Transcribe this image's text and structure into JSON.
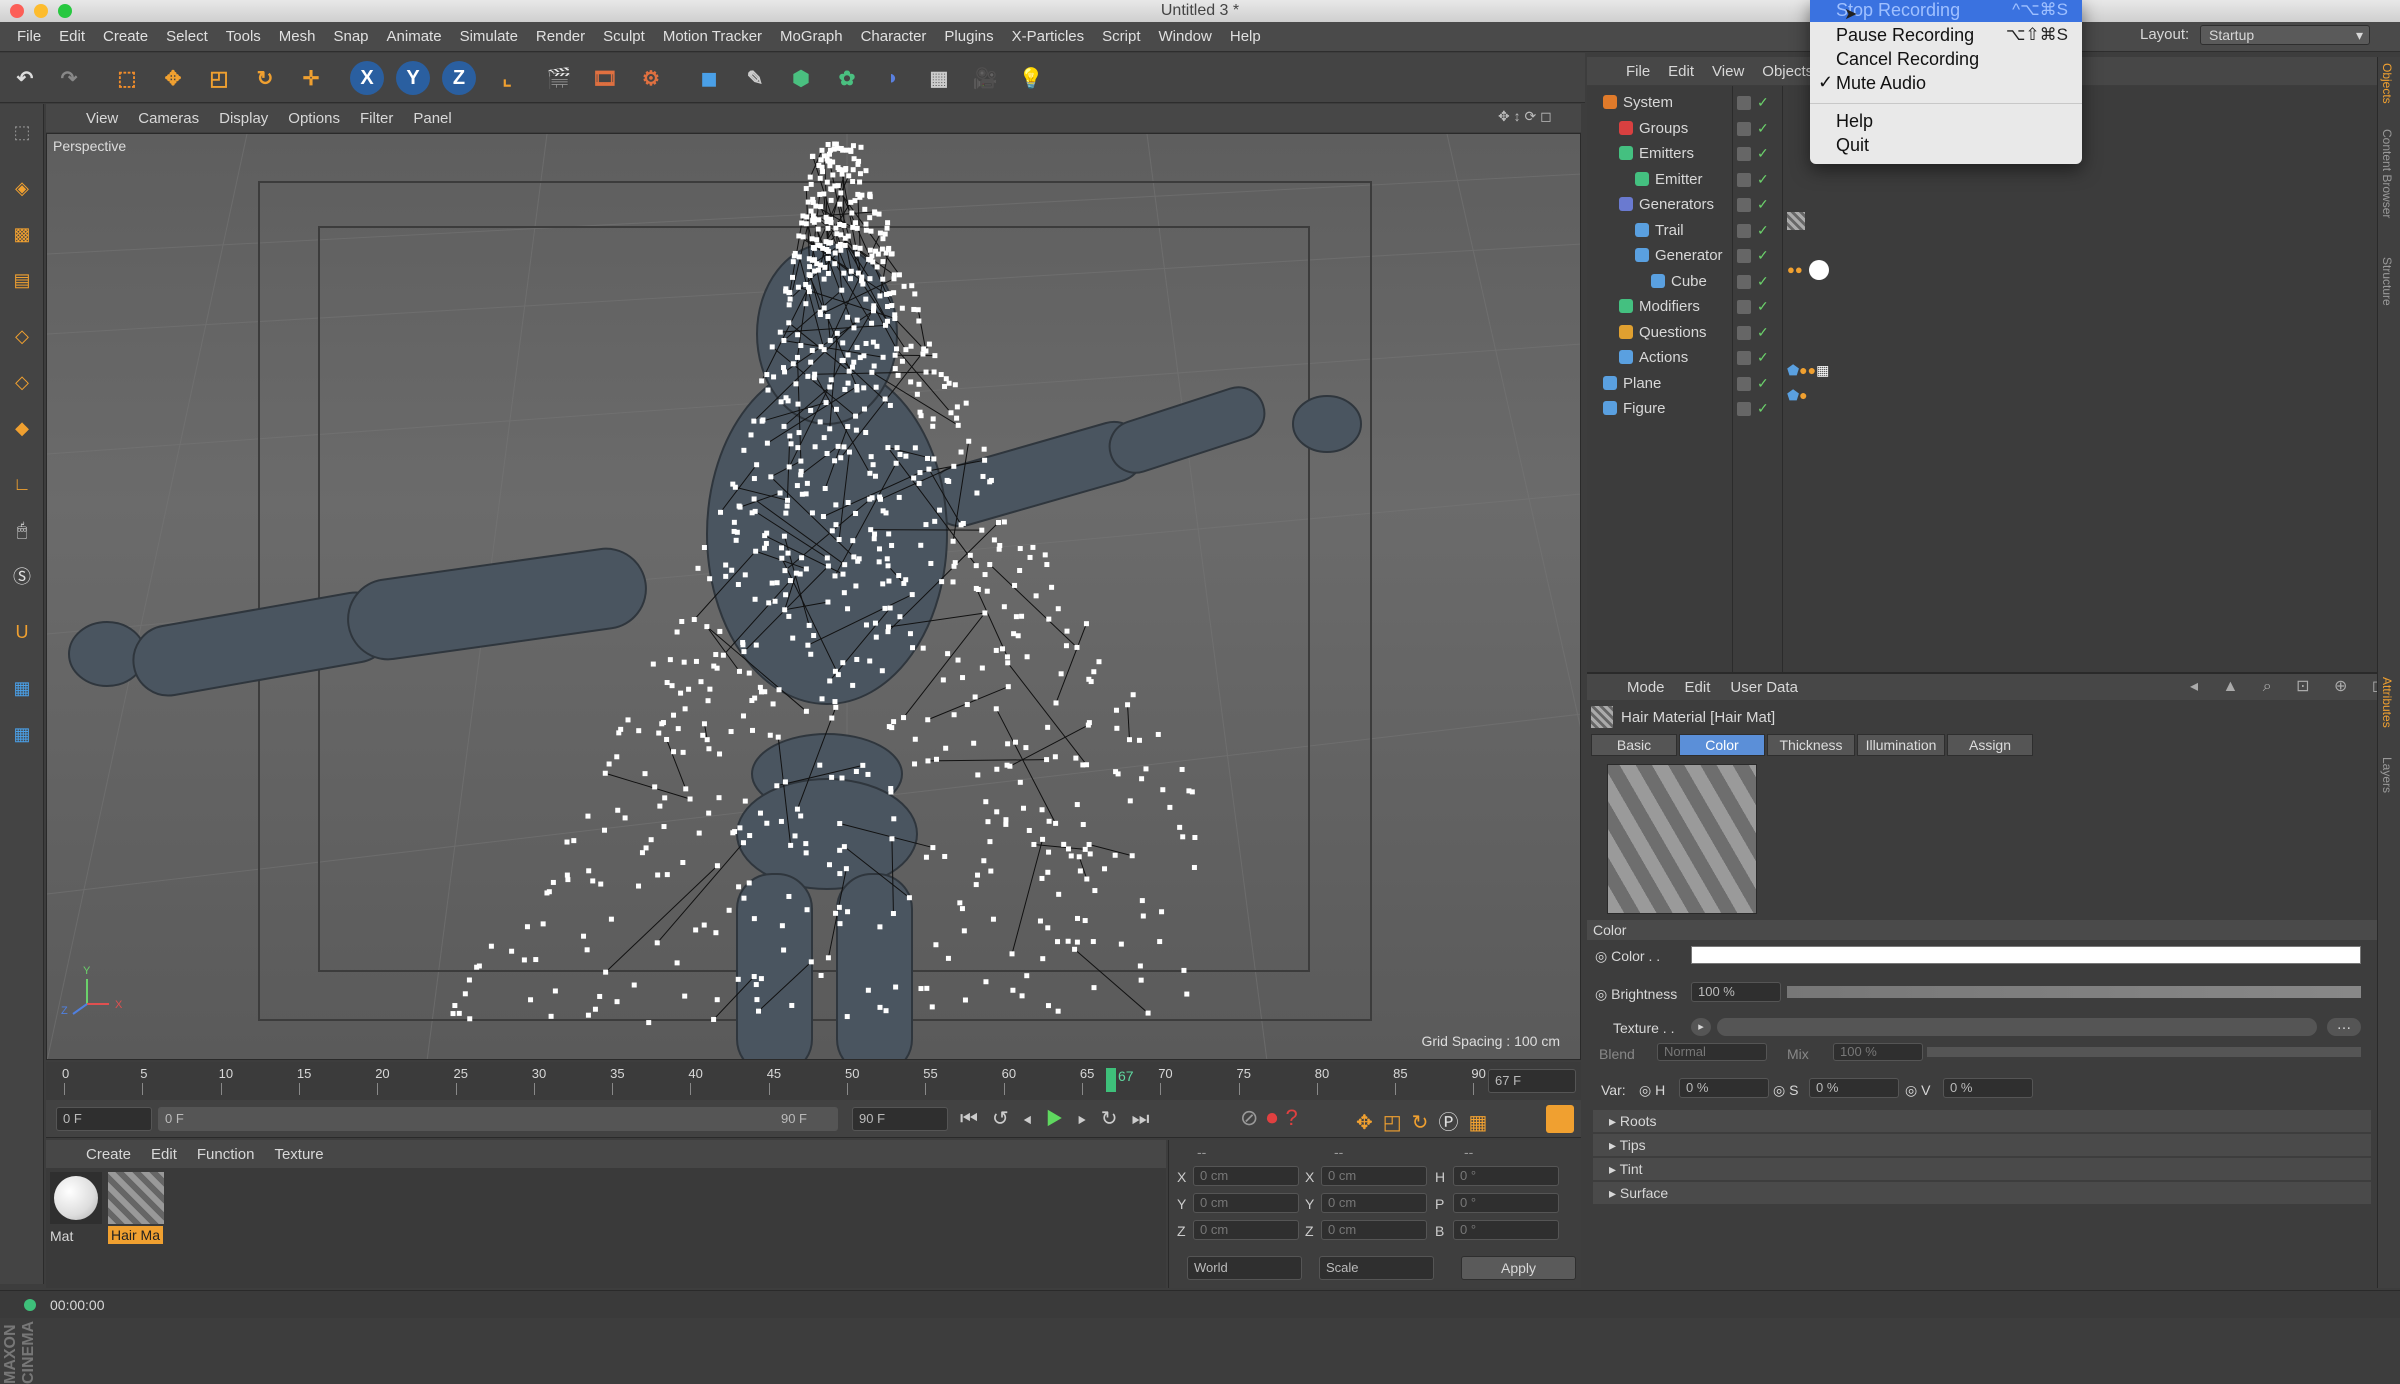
{
  "window": {
    "title": "Untitled 3 *"
  },
  "menubar": [
    "File",
    "Edit",
    "Create",
    "Select",
    "Tools",
    "Mesh",
    "Snap",
    "Animate",
    "Simulate",
    "Render",
    "Sculpt",
    "Motion Tracker",
    "MoGraph",
    "Character",
    "Plugins",
    "X-Particles",
    "Script",
    "Window",
    "Help"
  ],
  "layout": {
    "label": "Layout:",
    "value": "Startup"
  },
  "recording_menu": {
    "items": [
      {
        "label": "Stop Recording",
        "shortcut": "^⌥⌘S",
        "highlighted": true
      },
      {
        "label": "Pause Recording",
        "shortcut": "⌥⇧⌘S"
      },
      {
        "label": "Cancel Recording",
        "shortcut": ""
      },
      {
        "label": "Mute Audio",
        "checked": true,
        "shortcut": ""
      },
      {
        "label": "Help",
        "shortcut": ""
      },
      {
        "label": "Quit",
        "shortcut": ""
      }
    ]
  },
  "toolbar": {
    "axes": [
      "X",
      "Y",
      "Z"
    ]
  },
  "viewport": {
    "menu": [
      "View",
      "Cameras",
      "Display",
      "Options",
      "Filter",
      "Panel"
    ],
    "label": "Perspective",
    "grid_spacing": "Grid Spacing : 100 cm",
    "axis_labels": {
      "y": "Y",
      "z": "Z",
      "x": "X"
    }
  },
  "timeline": {
    "ticks": [
      "0",
      "5",
      "10",
      "15",
      "20",
      "25",
      "30",
      "35",
      "40",
      "45",
      "50",
      "55",
      "60",
      "65",
      "70",
      "75",
      "80",
      "85",
      "90"
    ],
    "current_frame": "67",
    "frame_display": "67 F",
    "start_field": "0 F",
    "range_start": "0 F",
    "range_end": "90 F",
    "end_field": "90 F"
  },
  "objects_menu": [
    "File",
    "Edit",
    "View",
    "Objects"
  ],
  "objects": [
    {
      "name": "System",
      "indent": 0,
      "color": "#e07a2a"
    },
    {
      "name": "Groups",
      "indent": 1,
      "color": "#d94040"
    },
    {
      "name": "Emitters",
      "indent": 1,
      "color": "#44c080"
    },
    {
      "name": "Emitter",
      "indent": 2,
      "color": "#44c080"
    },
    {
      "name": "Generators",
      "indent": 1,
      "color": "#6a7ad0"
    },
    {
      "name": "Trail",
      "indent": 2,
      "color": "#5aa0e0"
    },
    {
      "name": "Generator",
      "indent": 2,
      "color": "#5aa0e0"
    },
    {
      "name": "Cube",
      "indent": 3,
      "color": "#5aa0e0"
    },
    {
      "name": "Modifiers",
      "indent": 1,
      "color": "#44c080"
    },
    {
      "name": "Questions",
      "indent": 1,
      "color": "#e0a030"
    },
    {
      "name": "Actions",
      "indent": 1,
      "color": "#5aa0e0"
    },
    {
      "name": "Plane",
      "indent": 0,
      "color": "#5aa0e0"
    },
    {
      "name": "Figure",
      "indent": 0,
      "color": "#5aa0e0"
    }
  ],
  "attributes": {
    "menu": [
      "Mode",
      "Edit",
      "User Data"
    ],
    "title": "Hair Material [Hair Mat]",
    "tabs": [
      "Basic",
      "Color",
      "Thickness",
      "Illumination",
      "Assign"
    ],
    "active_tab": "Color",
    "section": "Color",
    "color_label": "Color . .",
    "brightness_label": "Brightness",
    "brightness_value": "100 %",
    "texture_label": "Texture . .",
    "blend_label": "Blend",
    "blend_value": "Normal",
    "mix_label": "Mix",
    "mix_value": "100 %",
    "var_label": "Var:",
    "var_h_label": "H",
    "var_h": "0 %",
    "var_s_label": "S",
    "var_s": "0 %",
    "var_v_label": "V",
    "var_v": "0 %",
    "sections": [
      "Roots",
      "Tips",
      "Tint",
      "Surface"
    ]
  },
  "materials": {
    "menu": [
      "Create",
      "Edit",
      "Function",
      "Texture"
    ],
    "items": [
      {
        "name": "Mat",
        "selected": false
      },
      {
        "name": "Hair Ma",
        "selected": true
      }
    ]
  },
  "coordinates": {
    "header": [
      "--",
      "--",
      "--"
    ],
    "rows": [
      {
        "a": "X",
        "av": "0 cm",
        "b": "X",
        "bv": "0 cm",
        "c": "H",
        "cv": "0 °"
      },
      {
        "a": "Y",
        "av": "0 cm",
        "b": "Y",
        "bv": "0 cm",
        "c": "P",
        "cv": "0 °"
      },
      {
        "a": "Z",
        "av": "0 cm",
        "b": "Z",
        "bv": "0 cm",
        "c": "B",
        "cv": "0 °"
      }
    ],
    "mode1": "World",
    "mode2": "Scale",
    "apply": "Apply"
  },
  "status": {
    "time": "00:00:00"
  },
  "side_tabs_top": [
    "Objects",
    "Content Browser",
    "Structure"
  ],
  "side_tabs_bottom": [
    "Attributes",
    "Layers"
  ],
  "brand": "MAXON CINEMA 4D"
}
